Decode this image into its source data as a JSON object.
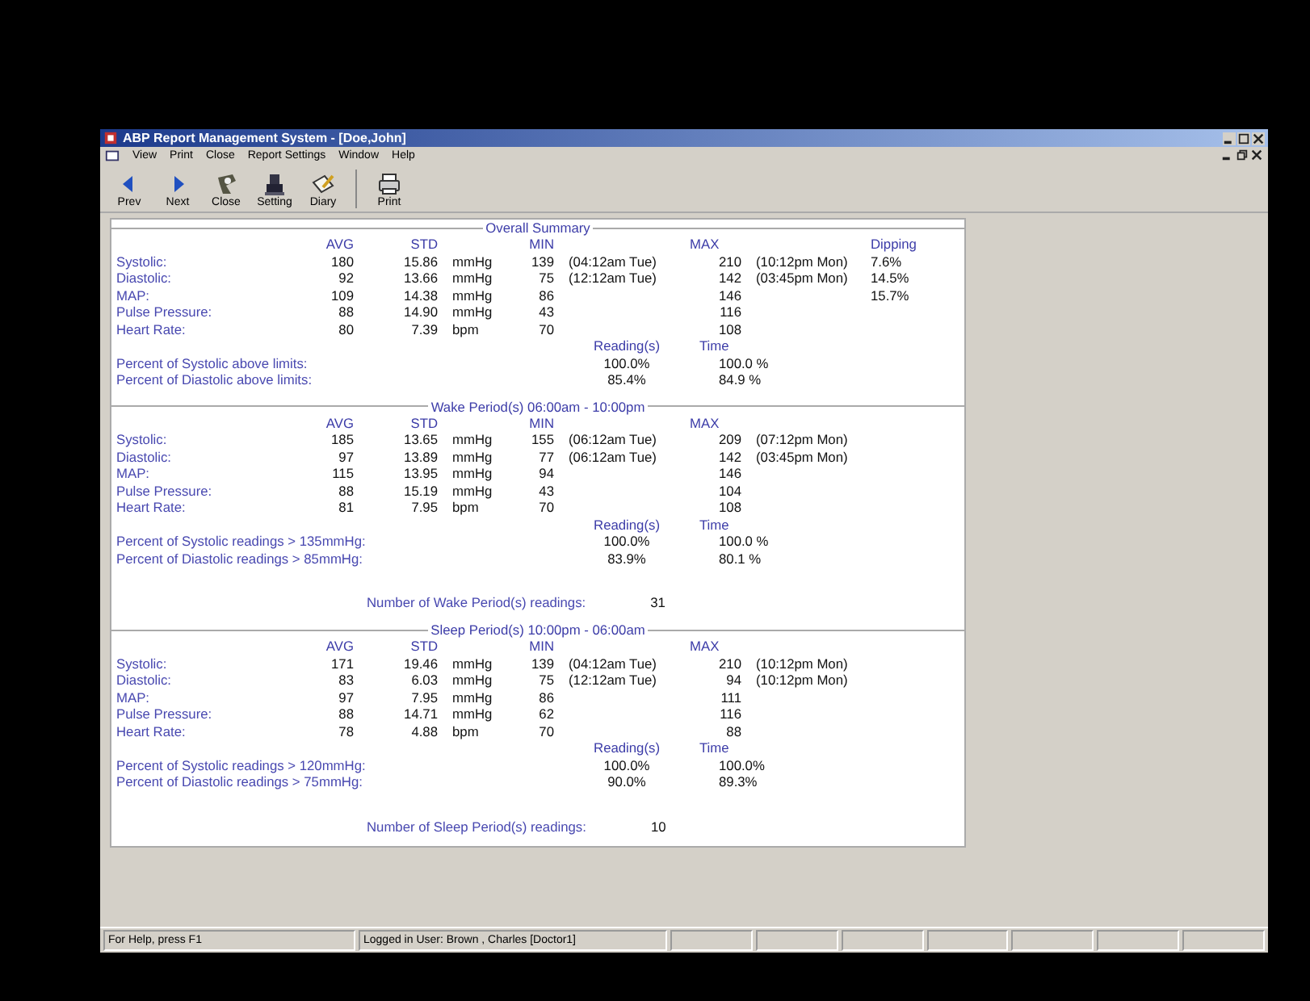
{
  "window": {
    "title": "ABP Report Management System - [Doe,John]"
  },
  "menu": [
    "View",
    "Print",
    "Close",
    "Report Settings",
    "Window",
    "Help"
  ],
  "toolbar": [
    {
      "kind": "prev",
      "label": "Prev"
    },
    {
      "kind": "next",
      "label": "Next"
    },
    {
      "kind": "close",
      "label": "Close"
    },
    {
      "kind": "setting",
      "label": "Setting"
    },
    {
      "kind": "diary",
      "label": "Diary"
    },
    {
      "kind": "print",
      "label": "Print"
    }
  ],
  "sections": [
    {
      "title": "Overall Summary",
      "columns": [
        "AVG",
        "STD",
        "MIN",
        "MAX",
        "Dipping"
      ],
      "rows": [
        {
          "label": "Systolic:",
          "avg": "180",
          "std": "15.86",
          "unit": "mmHg",
          "min": "139",
          "min_time": "(04:12am Tue)",
          "max": "210",
          "max_time": "(10:12pm Mon)",
          "dipping": "7.6%"
        },
        {
          "label": "Diastolic:",
          "avg": "92",
          "std": "13.66",
          "unit": "mmHg",
          "min": "75",
          "min_time": "(12:12am Tue)",
          "max": "142",
          "max_time": "(03:45pm Mon)",
          "dipping": "14.5%"
        },
        {
          "label": "MAP:",
          "avg": "109",
          "std": "14.38",
          "unit": "mmHg",
          "min": "86",
          "max": "146",
          "dipping": "15.7%"
        },
        {
          "label": "Pulse Pressure:",
          "avg": "88",
          "std": "14.90",
          "unit": "mmHg",
          "min": "43",
          "max": "116"
        },
        {
          "label": "Heart Rate:",
          "avg": "80",
          "std": "7.39",
          "unit": "bpm",
          "min": "70",
          "max": "108"
        }
      ],
      "percent_headers": [
        "Reading(s)",
        "Time"
      ],
      "percents": [
        {
          "label": "Percent of Systolic above limits:",
          "readings": "100.0%",
          "time": "100.0 %"
        },
        {
          "label": "Percent of Diastolic above limits:",
          "readings": "85.4%",
          "time": "84.9 %"
        }
      ]
    },
    {
      "title": "Wake Period(s) 06:00am - 10:00pm",
      "columns": [
        "AVG",
        "STD",
        "MIN",
        "MAX"
      ],
      "rows": [
        {
          "label": "Systolic:",
          "avg": "185",
          "std": "13.65",
          "unit": "mmHg",
          "min": "155",
          "min_time": "(06:12am Tue)",
          "max": "209",
          "max_time": "(07:12pm Mon)"
        },
        {
          "label": "Diastolic:",
          "avg": "97",
          "std": "13.89",
          "unit": "mmHg",
          "min": "77",
          "min_time": "(06:12am Tue)",
          "max": "142",
          "max_time": "(03:45pm Mon)"
        },
        {
          "label": "MAP:",
          "avg": "115",
          "std": "13.95",
          "unit": "mmHg",
          "min": "94",
          "max": "146"
        },
        {
          "label": "Pulse Pressure:",
          "avg": "88",
          "std": "15.19",
          "unit": "mmHg",
          "min": "43",
          "max": "104"
        },
        {
          "label": "Heart Rate:",
          "avg": "81",
          "std": "7.95",
          "unit": "bpm",
          "min": "70",
          "max": "108"
        }
      ],
      "percent_headers": [
        "Reading(s)",
        "Time"
      ],
      "percents": [
        {
          "label": "Percent of Systolic readings > 135mmHg:",
          "readings": "100.0%",
          "time": "100.0 %"
        },
        {
          "label": "Percent of Diastolic readings > 85mmHg:",
          "readings": "83.9%",
          "time": "80.1 %"
        }
      ],
      "count": {
        "label": "Number of Wake Period(s) readings:",
        "value": "31"
      }
    },
    {
      "title": "Sleep Period(s) 10:00pm - 06:00am",
      "columns": [
        "AVG",
        "STD",
        "MIN",
        "MAX"
      ],
      "rows": [
        {
          "label": "Systolic:",
          "avg": "171",
          "std": "19.46",
          "unit": "mmHg",
          "min": "139",
          "min_time": "(04:12am Tue)",
          "max": "210",
          "max_time": "(10:12pm Mon)"
        },
        {
          "label": "Diastolic:",
          "avg": "83",
          "std": "6.03",
          "unit": "mmHg",
          "min": "75",
          "min_time": "(12:12am Tue)",
          "max": "94",
          "max_time": "(10:12pm Mon)"
        },
        {
          "label": "MAP:",
          "avg": "97",
          "std": "7.95",
          "unit": "mmHg",
          "min": "86",
          "max": "111"
        },
        {
          "label": "Pulse Pressure:",
          "avg": "88",
          "std": "14.71",
          "unit": "mmHg",
          "min": "62",
          "max": "116"
        },
        {
          "label": "Heart Rate:",
          "avg": "78",
          "std": "4.88",
          "unit": "bpm",
          "min": "70",
          "max": "88"
        }
      ],
      "percent_headers": [
        "Reading(s)",
        "Time"
      ],
      "percents": [
        {
          "label": "Percent of Systolic readings > 120mmHg:",
          "readings": "100.0%",
          "time": "100.0%"
        },
        {
          "label": "Percent of Diastolic readings > 75mmHg:",
          "readings": "90.0%",
          "time": "89.3%"
        }
      ],
      "count": {
        "label": "Number of Sleep Period(s) readings:",
        "value": "10"
      }
    }
  ],
  "status_bar": [
    "For Help, press F1",
    "Logged in User: Brown , Charles [Doctor1]"
  ]
}
